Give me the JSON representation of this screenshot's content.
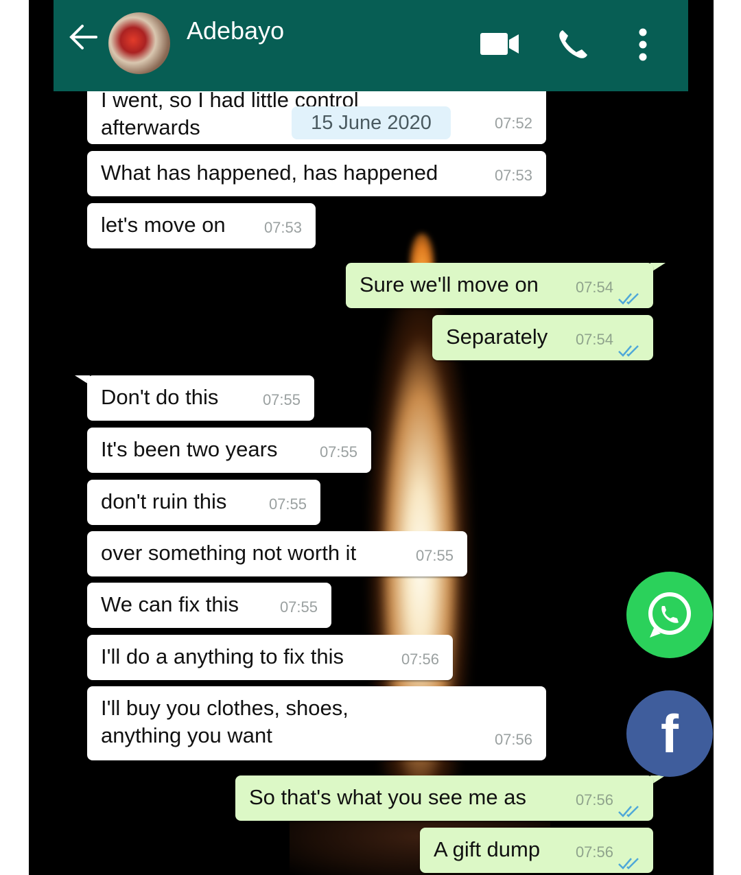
{
  "header": {
    "title": "Adebayo",
    "icons": [
      "back-arrow-icon",
      "avatar",
      "video-call-icon",
      "phone-icon",
      "menu-dots-icon"
    ],
    "color": "#075e54"
  },
  "chat": {
    "date_chip": "15 June 2020",
    "messages": [
      {
        "dir": "in",
        "text_line1": "I went, so I had little control",
        "text": "afterwards",
        "time": "07:52"
      },
      {
        "dir": "in",
        "text": "What has happened, has happened",
        "time": "07:53"
      },
      {
        "dir": "in",
        "text": "let's move on",
        "time": "07:53"
      },
      {
        "dir": "out",
        "text": "Sure we'll move on",
        "time": "07:54"
      },
      {
        "dir": "out",
        "text": "Separately",
        "time": "07:54"
      },
      {
        "dir": "in",
        "text": "Don't do this",
        "time": "07:55"
      },
      {
        "dir": "in",
        "text": "It's been two years",
        "time": "07:55"
      },
      {
        "dir": "in",
        "text": "don't ruin this",
        "time": "07:55"
      },
      {
        "dir": "in",
        "text": "over something not worth it",
        "time": "07:55"
      },
      {
        "dir": "in",
        "text": "We can fix this",
        "time": "07:55"
      },
      {
        "dir": "in",
        "text": "I'll do a anything to fix this",
        "time": "07:56"
      },
      {
        "dir": "in",
        "text_line1": "I'll buy you clothes, shoes,",
        "text": "anything you want",
        "time": "07:56"
      },
      {
        "dir": "out",
        "text": "So that's what you see me as",
        "time": "07:56"
      },
      {
        "dir": "out",
        "text": "A gift dump",
        "time": "07:56"
      }
    ]
  },
  "share": {
    "whatsapp_color": "#2bd15b",
    "facebook_color": "#3f5d9c",
    "facebook_glyph": "f"
  }
}
